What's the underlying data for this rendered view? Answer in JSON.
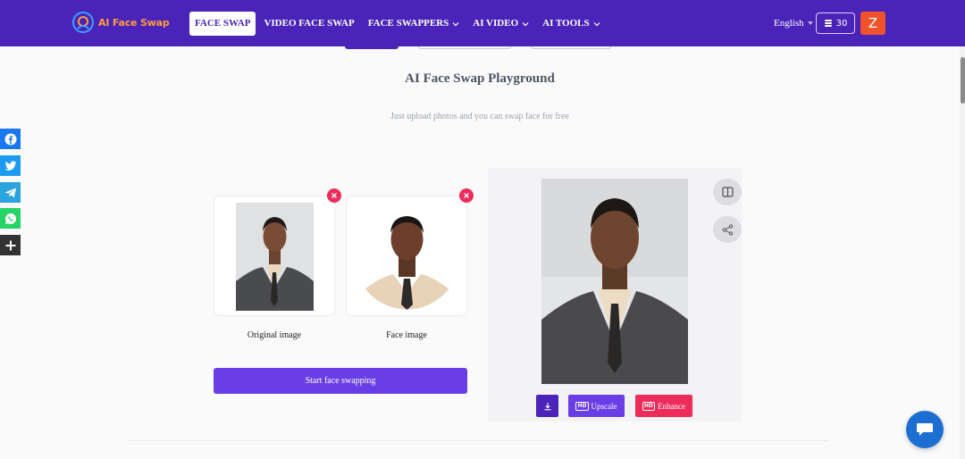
{
  "header": {
    "logo_text": "AI Face Swap",
    "nav": [
      {
        "label": "FACE SWAP",
        "active": true,
        "dropdown": false
      },
      {
        "label": "VIDEO FACE SWAP",
        "active": false,
        "dropdown": false
      },
      {
        "label": "FACE SWAPPERS",
        "active": false,
        "dropdown": true
      },
      {
        "label": "AI VIDEO",
        "active": false,
        "dropdown": true
      },
      {
        "label": "AI TOOLS",
        "active": false,
        "dropdown": true
      }
    ],
    "language": "English",
    "credits": "30",
    "avatar_initial": "Z",
    "colors": {
      "bg": "#4a24b8",
      "logo": "#ff9d3b",
      "avatar": "#f0532a"
    }
  },
  "main": {
    "title": "AI Face Swap Playground",
    "subtitle": "Just upload photos and you can swap face for free"
  },
  "share_rail": [
    "facebook-icon",
    "twitter-icon",
    "telegram-icon",
    "whatsapp-icon",
    "plus-icon"
  ],
  "uploads": {
    "original_label": "Original image",
    "face_label": "Face image",
    "start_button": "Start face swapping"
  },
  "result": {
    "upscale_label": "Upscale",
    "enhance_label": "Enhance",
    "hd_badge": "HD"
  },
  "accent_colors": {
    "purple": "#6a3ee6",
    "pink": "#ee2c5b",
    "chat": "#1c6fd1"
  }
}
